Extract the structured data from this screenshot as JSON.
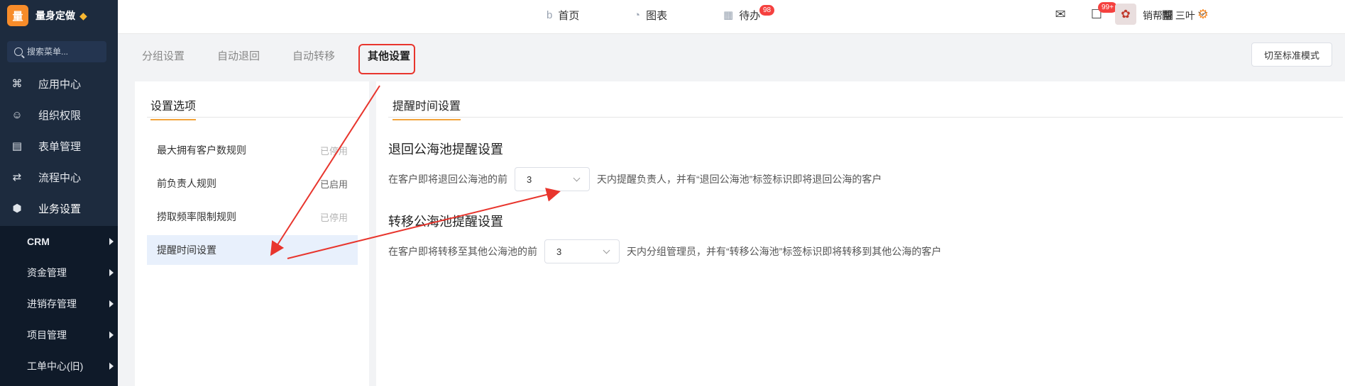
{
  "brand": {
    "logo_text": "量",
    "name": "量身定做"
  },
  "search": {
    "placeholder": "搜索菜单..."
  },
  "sidebar": {
    "items": [
      {
        "label": "应用中心",
        "icon": "app-grid-icon"
      },
      {
        "label": "组织权限",
        "icon": "person-icon"
      },
      {
        "label": "表单管理",
        "icon": "form-icon"
      },
      {
        "label": "流程中心",
        "icon": "flow-icon"
      },
      {
        "label": "业务设置",
        "icon": "cube-icon"
      }
    ],
    "sub_items": [
      {
        "label": "CRM"
      },
      {
        "label": "资金管理"
      },
      {
        "label": "进销存管理"
      },
      {
        "label": "项目管理"
      },
      {
        "label": "工单中心(旧)"
      }
    ]
  },
  "topnav": {
    "items": [
      {
        "label": "首页",
        "icon": "home-icon"
      },
      {
        "label": "图表",
        "icon": "chart-icon"
      },
      {
        "label": "待办",
        "icon": "calendar-icon",
        "badge": "98"
      }
    ]
  },
  "toolbar": {
    "message_badge": "99+",
    "user_name": "销帮帮 三叶"
  },
  "tabs": [
    {
      "label": "分组设置"
    },
    {
      "label": "自动退回"
    },
    {
      "label": "自动转移"
    },
    {
      "label": "其他设置"
    }
  ],
  "switch_button": "切至标准模式",
  "left_panel": {
    "title": "设置选项",
    "rules": [
      {
        "label": "最大拥有客户数规则",
        "status": "已停用"
      },
      {
        "label": "前负责人规则",
        "status": "已启用"
      },
      {
        "label": "捞取频率限制规则",
        "status": "已停用"
      },
      {
        "label": "提醒时间设置",
        "status": ""
      }
    ]
  },
  "right_panel": {
    "title": "提醒时间设置",
    "sections": [
      {
        "title": "退回公海池提醒设置",
        "prefix": "在客户即将退回公海池的前",
        "value": "3",
        "suffix": "天内提醒负责人，并有“退回公海池”标签标识即将退回公海的客户"
      },
      {
        "title": "转移公海池提醒设置",
        "prefix": "在客户即将转移至其他公海池的前",
        "value": "3",
        "suffix": "天内分组管理员，并有“转移公海池”标签标识即将转移到其他公海的客户"
      }
    ]
  },
  "colors": {
    "sidebar_bg": "#1d2b3e",
    "accent": "#f78c2a",
    "annotation_red": "#e8352d",
    "badge_red": "#f5413f"
  }
}
